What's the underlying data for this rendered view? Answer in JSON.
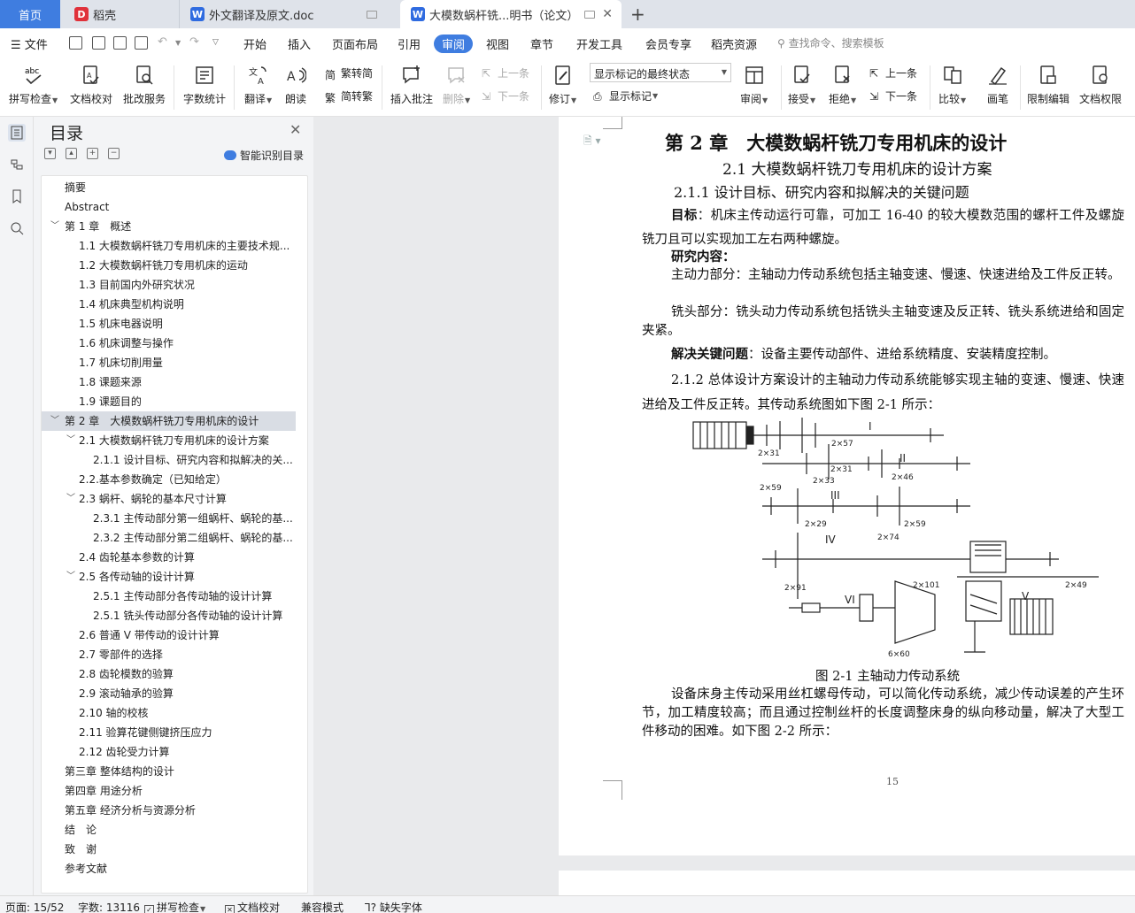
{
  "tabs": [
    {
      "label": "首页"
    },
    {
      "label": "稻壳",
      "icon": "daoke-icon"
    },
    {
      "label": "外文翻译及原文.doc",
      "icon": "word-doc-icon"
    },
    {
      "label": "大模数蜗杆铣...明书（论文）",
      "icon": "word-doc-icon"
    }
  ],
  "menu": {
    "file": "文件",
    "items": [
      "开始",
      "插入",
      "页面布局",
      "引用",
      "审阅",
      "视图",
      "章节",
      "开发工具",
      "会员专享",
      "稻壳资源"
    ],
    "active": "审阅",
    "search_placeholder": "查找命令、搜索模板"
  },
  "ribbon": {
    "spell_check": "拼写检查",
    "doc_proof": "文档校对",
    "batch_service": "批改服务",
    "word_count": "字数统计",
    "translate": "翻译",
    "read_aloud": "朗读",
    "trad_to_simp": "繁转简",
    "simp_to_trad": "简转繁",
    "insert_comment": "插入批注",
    "delete": "删除",
    "prev": "上一条",
    "next": "下一条",
    "revise": "修订",
    "markup_mode": "显示标记的最终状态",
    "show_markup": "显示标记",
    "review": "审阅",
    "accept": "接受",
    "reject": "拒绝",
    "prev2": "上一条",
    "next2": "下一条",
    "compare": "比较",
    "pen": "画笔",
    "restrict_edit": "限制编辑",
    "doc_permission": "文档权限"
  },
  "toc": {
    "title": "目录",
    "smart_label": "智能识别目录",
    "items": [
      {
        "label": "摘要",
        "level": 1
      },
      {
        "label": "Abstract",
        "level": 1
      },
      {
        "label": "第 1 章　概述",
        "level": 1,
        "expanded": true
      },
      {
        "label": "1.1 大模数蜗杆铣刀专用机床的主要技术规...",
        "level": 2
      },
      {
        "label": "1.2 大模数蜗杆铣刀专用机床的运动",
        "level": 2
      },
      {
        "label": "1.3 目前国内外研究状况",
        "level": 2
      },
      {
        "label": "1.4 机床典型机构说明",
        "level": 2
      },
      {
        "label": "1.5 机床电器说明",
        "level": 2
      },
      {
        "label": "1.6 机床调整与操作",
        "level": 2
      },
      {
        "label": "1.7 机床切削用量",
        "level": 2
      },
      {
        "label": "1.8 课题来源",
        "level": 2
      },
      {
        "label": "1.9 课题目的",
        "level": 2
      },
      {
        "label": "第 2 章　大模数蜗杆铣刀专用机床的设计",
        "level": 1,
        "expanded": true,
        "selected": true
      },
      {
        "label": "2.1 大模数蜗杆铣刀专用机床的设计方案",
        "level": 2,
        "expanded": true
      },
      {
        "label": "2.1.1 设计目标、研究内容和拟解决的关...",
        "level": 3
      },
      {
        "label": "2.2.基本参数确定（已知给定）",
        "level": 2
      },
      {
        "label": "2.3 蜗杆、蜗轮的基本尺寸计算",
        "level": 2,
        "expanded": true
      },
      {
        "label": "2.3.1 主传动部分第一组蜗杆、蜗轮的基...",
        "level": 3
      },
      {
        "label": "2.3.2 主传动部分第二组蜗杆、蜗轮的基...",
        "level": 3
      },
      {
        "label": "2.4 齿轮基本参数的计算",
        "level": 2
      },
      {
        "label": "2.5 各传动轴的设计计算",
        "level": 2,
        "expanded": true
      },
      {
        "label": "2.5.1 主传动部分各传动轴的设计计算",
        "level": 3
      },
      {
        "label": "2.5.1 铣头传动部分各传动轴的设计计算",
        "level": 3
      },
      {
        "label": "2.6 普通 V 带传动的设计计算",
        "level": 2
      },
      {
        "label": "2.7 零部件的选择",
        "level": 2
      },
      {
        "label": "2.8 齿轮模数的验算",
        "level": 2
      },
      {
        "label": "2.9 滚动轴承的验算",
        "level": 2
      },
      {
        "label": "2.10 轴的校核",
        "level": 2
      },
      {
        "label": "2.11 验算花键侧键挤压应力",
        "level": 2
      },
      {
        "label": "2.12 齿轮受力计算",
        "level": 2
      },
      {
        "label": "第三章  整体结构的设计",
        "level": 1
      },
      {
        "label": "第四章  用途分析",
        "level": 1
      },
      {
        "label": "第五章  经济分析与资源分析",
        "level": 1
      },
      {
        "label": "结　论",
        "level": 1
      },
      {
        "label": "致　谢",
        "level": 1
      },
      {
        "label": "参考文献",
        "level": 1
      }
    ]
  },
  "document": {
    "h1": "第 2 章　大模数蜗杆铣刀专用机床的设计",
    "h2": "2.1 大模数蜗杆铣刀专用机床的设计方案",
    "h3": "2.1.1 设计目标、研究内容和拟解决的关键问题",
    "goal_label": "目标",
    "goal_text": "：机床主传动运行可靠，可加工 16-40 的较大模数范围的螺杆工件及螺旋铣刀且可以实现加工左右两种螺旋。",
    "research_label": "研究内容",
    "research_colon": "：",
    "main_drive": "主动力部分：主轴动力传动系统包括主轴变速、慢速、快速进给及工件反正转。",
    "mill_head": "铣头部分：铣头动力传动系统包括铣头主轴变速及反正转、铣头系统进给和固定夹紧。",
    "key_label": "解决关键问题",
    "key_text": "：设备主要传动部件、进给系统精度、安装精度控制。",
    "overall": "2.1.2 总体设计方案设计的主轴动力传动系统能够实现主轴的变速、慢速、快速进给及工件反正转。其传动系统图如下图 2-1 所示：",
    "fig_caption": "图 2-1  主轴动力传动系统",
    "after_fig": "设备床身主传动采用丝杠螺母传动，可以简化传动系统，减少传动误差的产生环节，加工精度较高；而且通过控制丝杆的长度调整床身的纵向移动量，解决了大型工件移动的困难。如下图 2-2 所示：",
    "page_number": "15",
    "figure_labels": {
      "shaft_I": "I",
      "shaft_II": "II",
      "shaft_III": "III",
      "shaft_IV": "IV",
      "shaft_V": "V",
      "shaft_VI": "VI",
      "g1": "2×57",
      "g2": "2×31",
      "g3": "2×31",
      "g4": "2×46",
      "g5": "2×33",
      "g6": "2×59",
      "g7": "2×29",
      "g8": "2×59",
      "g9": "2×74",
      "g10": "2×91",
      "g11": "2×101",
      "g12": "2×49",
      "g13": "6×60"
    }
  },
  "status": {
    "page": "页面: 15/52",
    "words": "字数: 13116",
    "spell": "拼写检查",
    "proof": "文档校对",
    "compat": "兼容模式",
    "missing_font": "缺失字体"
  }
}
